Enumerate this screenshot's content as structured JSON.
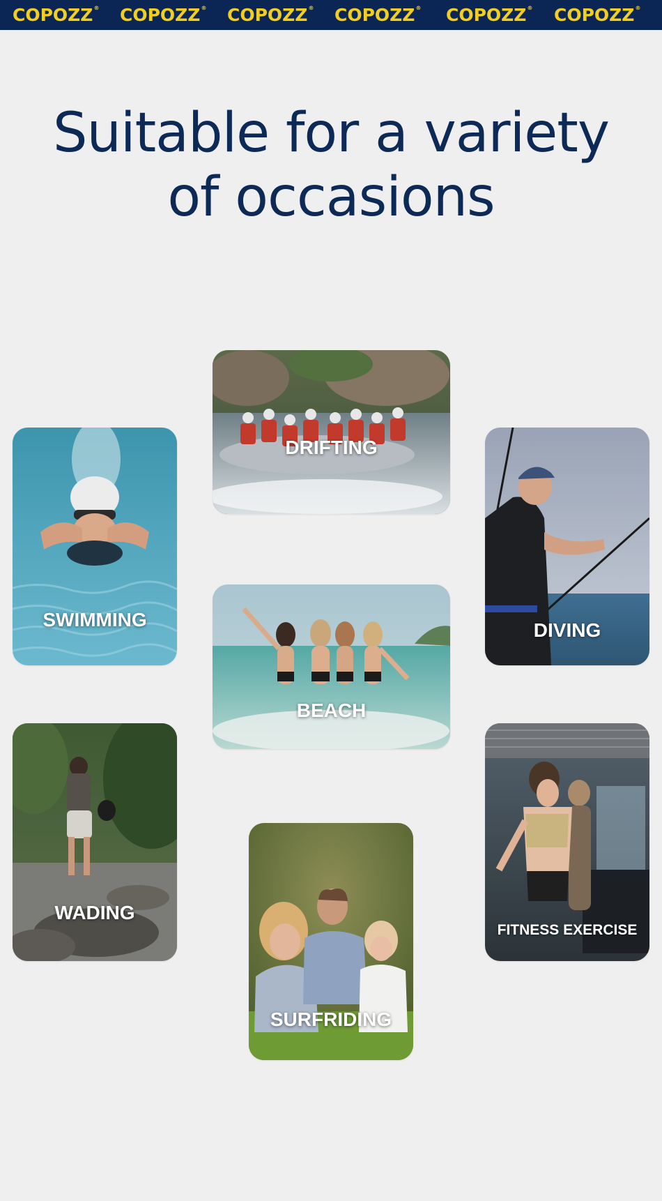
{
  "brand": {
    "logo_text": "COPOZZ",
    "registered_mark": "®",
    "bar_color": "#0b2654",
    "logo_color": "#f2cf1f"
  },
  "headline": {
    "line1": "Suitable for a variety",
    "line2": "of occasions",
    "color": "#0d2a57"
  },
  "occasions": {
    "drifting": "DRIFTING",
    "swimming": "SWIMMING",
    "diving": "DIVING",
    "beach": "BEACH",
    "wading": "WADING",
    "fitness": "FITNESS EXERCISE",
    "surfriding": "SURFRIDING"
  }
}
